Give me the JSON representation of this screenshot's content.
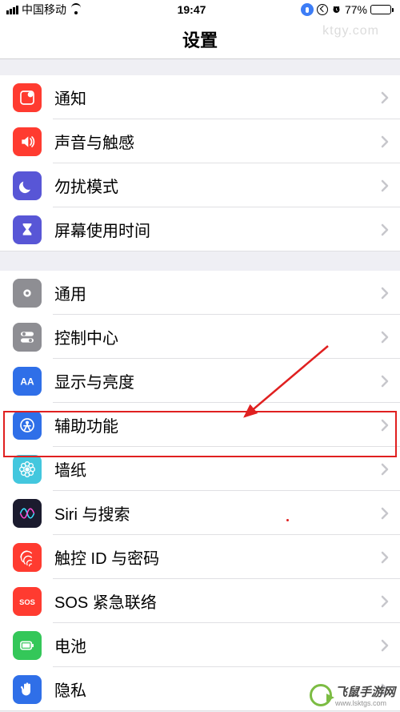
{
  "status": {
    "carrier": "中国移动",
    "time": "19:47",
    "battery_pct": "77%"
  },
  "title": "设置",
  "groups": [
    {
      "items": [
        {
          "key": "notifications",
          "label": "通知",
          "icon": "notify",
          "color": "#ff3b30"
        },
        {
          "key": "sounds",
          "label": "声音与触感",
          "icon": "speaker",
          "color": "#ff3b30"
        },
        {
          "key": "dnd",
          "label": "勿扰模式",
          "icon": "moon",
          "color": "#5856d6"
        },
        {
          "key": "screentime",
          "label": "屏幕使用时间",
          "icon": "hourglass",
          "color": "#5856d6"
        }
      ]
    },
    {
      "items": [
        {
          "key": "general",
          "label": "通用",
          "icon": "gear",
          "color": "#8e8e93"
        },
        {
          "key": "control",
          "label": "控制中心",
          "icon": "switches",
          "color": "#8e8e93"
        },
        {
          "key": "display",
          "label": "显示与亮度",
          "icon": "aa",
          "color": "#2f6fe8"
        },
        {
          "key": "accessibility",
          "label": "辅助功能",
          "icon": "person",
          "color": "#2f6fe8",
          "highlight": true
        },
        {
          "key": "wallpaper",
          "label": "墙纸",
          "icon": "flower",
          "color": "#43c7de"
        },
        {
          "key": "siri",
          "label": "Siri 与搜索",
          "icon": "siri",
          "color": "#1b1b2e"
        },
        {
          "key": "touchid",
          "label": "触控 ID 与密码",
          "icon": "finger",
          "color": "#ff3b30"
        },
        {
          "key": "sos",
          "label": "SOS 紧急联络",
          "icon": "sos",
          "color": "#ff3b30"
        },
        {
          "key": "battery",
          "label": "电池",
          "icon": "batt",
          "color": "#34c759"
        },
        {
          "key": "privacy",
          "label": "隐私",
          "icon": "hand",
          "color": "#2f6fe8"
        }
      ]
    }
  ],
  "watermark": {
    "brand": "飞鼠手游网",
    "url": "www.lsktgs.com"
  },
  "faint_url": "ktgy.com"
}
